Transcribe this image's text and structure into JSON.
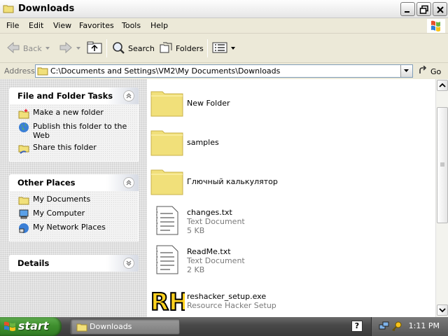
{
  "window": {
    "title": "Downloads"
  },
  "menu": [
    "File",
    "Edit",
    "View",
    "Favorites",
    "Tools",
    "Help"
  ],
  "toolbar": {
    "back_label": "Back",
    "search_label": "Search",
    "folders_label": "Folders"
  },
  "address": {
    "label": "Address",
    "path": "C:\\Documents and Settings\\VM2\\My Documents\\Downloads",
    "go_label": "Go"
  },
  "taskpane": {
    "file_tasks": {
      "title": "File and Folder Tasks",
      "items": [
        "Make a new folder",
        "Publish this folder to the Web",
        "Share this folder"
      ]
    },
    "other_places": {
      "title": "Other Places",
      "items": [
        "My Documents",
        "My Computer",
        "My Network Places"
      ]
    },
    "details": {
      "title": "Details"
    }
  },
  "files": [
    {
      "name": "New Folder",
      "type": "",
      "size": "",
      "icon": "folder-icon"
    },
    {
      "name": "samples",
      "type": "",
      "size": "",
      "icon": "folder-icon"
    },
    {
      "name": "Глючный калькулятор",
      "type": "",
      "size": "",
      "icon": "folder-icon"
    },
    {
      "name": "changes.txt",
      "type": "Text Document",
      "size": "5 KB",
      "icon": "text-document-icon"
    },
    {
      "name": "ReadMe.txt",
      "type": "Text Document",
      "size": "2 KB",
      "icon": "text-document-icon"
    },
    {
      "name": "reshacker_setup.exe",
      "type": "Resource Hacker Setup",
      "size": "",
      "icon": "resource-hacker-icon"
    }
  ],
  "taskbar": {
    "start_label": "start",
    "window_button": "Downloads",
    "clock": "1:11 PM"
  },
  "colors": {
    "folder_yellow": "#F1E07A",
    "start_green": "#3F8F2E",
    "taskbar_gray": "#4A4A4A"
  }
}
